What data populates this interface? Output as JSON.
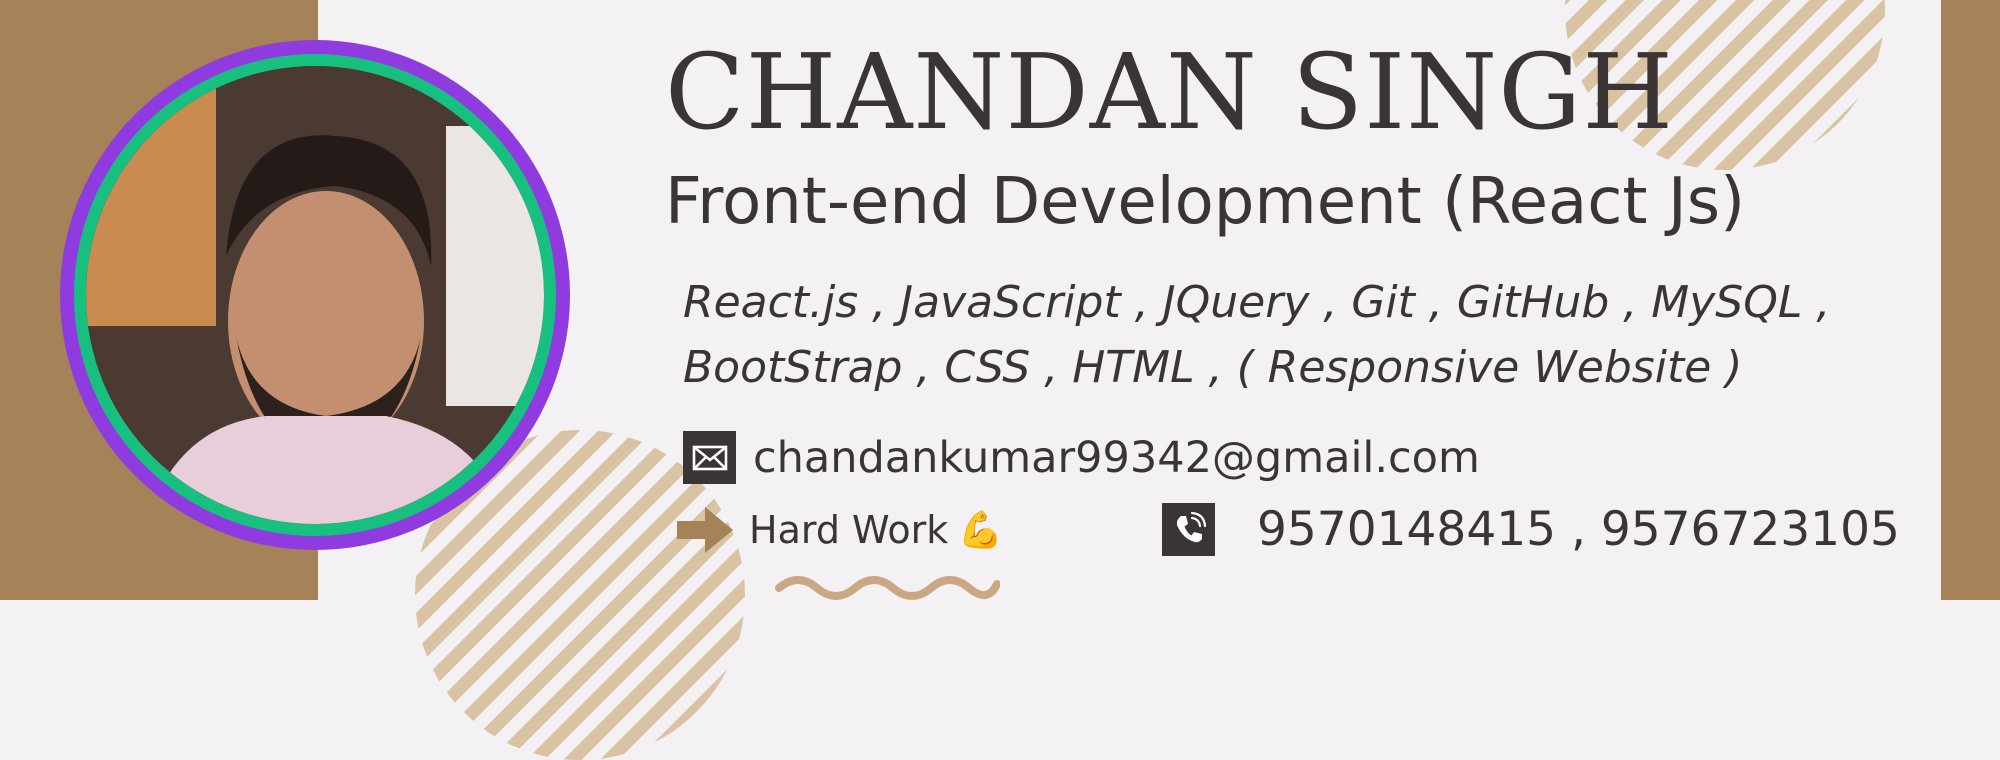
{
  "profile": {
    "name": "CHANDAN SINGH",
    "role": "Front-end Development (React Js)",
    "skills_line1": "React.js , JavaScript , JQuery , Git , GitHub , MySQL ,",
    "skills_line2": "BootStrap , CSS , HTML , ( Responsive Website )",
    "email": "chandankumar99342@gmail.com",
    "motto": "Hard Work",
    "motto_emoji": "💪",
    "phones": "9570148415 , 9576723105"
  },
  "icons": {
    "email": "envelope-icon",
    "motto": "arrow-right-icon",
    "phone": "phone-icon"
  },
  "colors": {
    "band": "#a68259",
    "background": "#f3f1f4",
    "text": "#3a3435",
    "ring_outer": "#8f3be0",
    "ring_inner": "#18c080",
    "stripes": "#d9c3a3"
  }
}
